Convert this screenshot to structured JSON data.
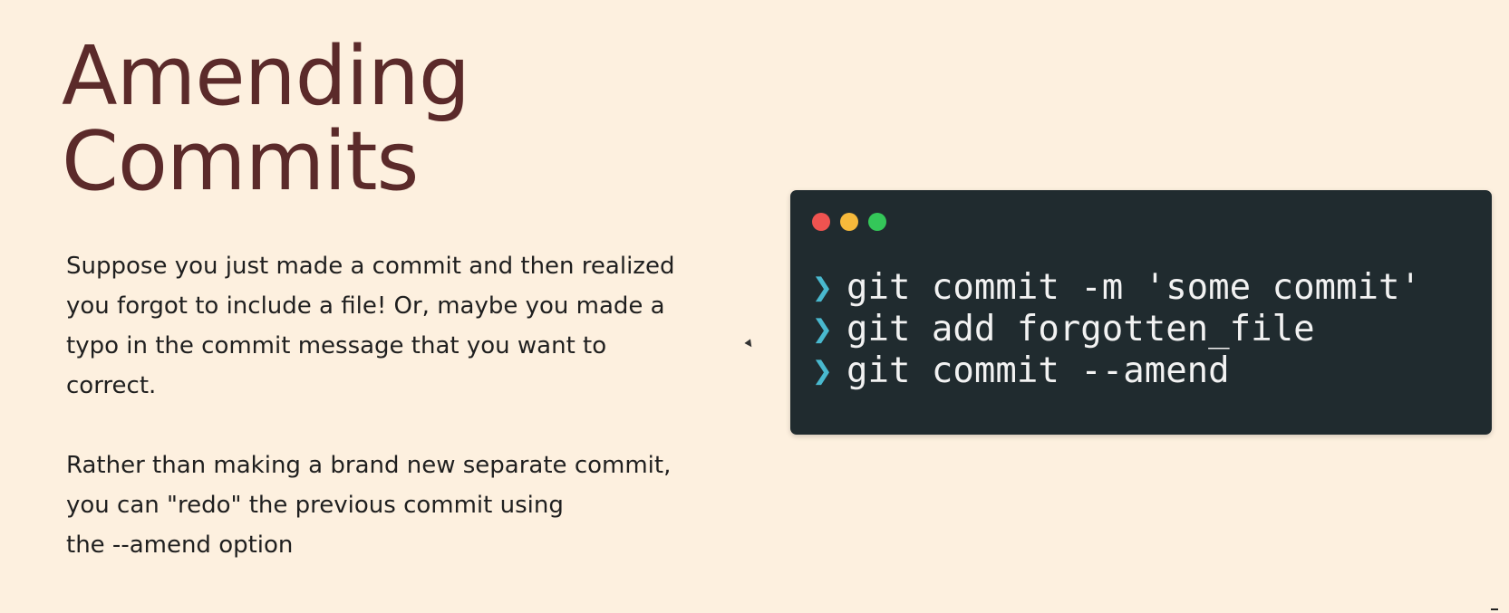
{
  "slide": {
    "title_lines": [
      "Amending",
      "Commits"
    ],
    "paragraph_1_lines": [
      "Suppose you just made a commit and then realized",
      "you forgot to include a file! Or, maybe you made a",
      "typo in the commit message that you want to",
      "correct."
    ],
    "paragraph_2_lines": [
      "Rather than making a brand new separate commit,",
      "you can \"redo\" the previous commit using",
      "the --amend option"
    ]
  },
  "terminal": {
    "window_buttons": {
      "close_color": "#ef5350",
      "minimize_color": "#f6b93b",
      "zoom_color": "#34c759"
    },
    "prompt_symbol": "❯",
    "commands": [
      "git commit -m 'some commit'",
      "git add forgotten_file",
      "git commit --amend"
    ]
  },
  "colors": {
    "background": "#fdf0df",
    "title": "#5b2a2a",
    "text": "#1f1f1f",
    "terminal_background": "#202b2f",
    "prompt": "#49b9cf"
  }
}
